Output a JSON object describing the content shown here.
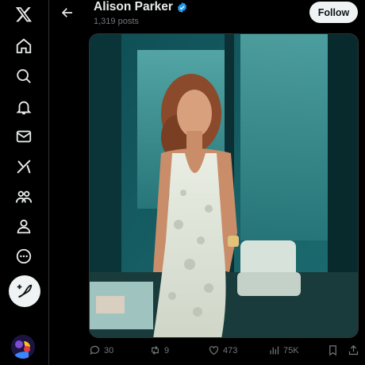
{
  "sidebar": {
    "items": [
      {
        "icon": "x-logo-icon"
      },
      {
        "icon": "home-icon"
      },
      {
        "icon": "search-icon"
      },
      {
        "icon": "bell-icon"
      },
      {
        "icon": "mail-icon"
      },
      {
        "icon": "grok-icon"
      },
      {
        "icon": "communities-icon"
      },
      {
        "icon": "profile-icon"
      },
      {
        "icon": "more-icon"
      }
    ],
    "compose_icon": "feather-plus-icon"
  },
  "header": {
    "name": "Alison Parker",
    "posts": "1,319 posts",
    "follow_label": "Follow",
    "verified_color": "#1d9bf0"
  },
  "actions": {
    "replies": "30",
    "reposts": "9",
    "likes": "473",
    "views": "75K"
  },
  "colors": {
    "background": "#000000",
    "muted_text": "#71767b",
    "border": "#2f3336",
    "button_bg": "#eff3f4"
  }
}
